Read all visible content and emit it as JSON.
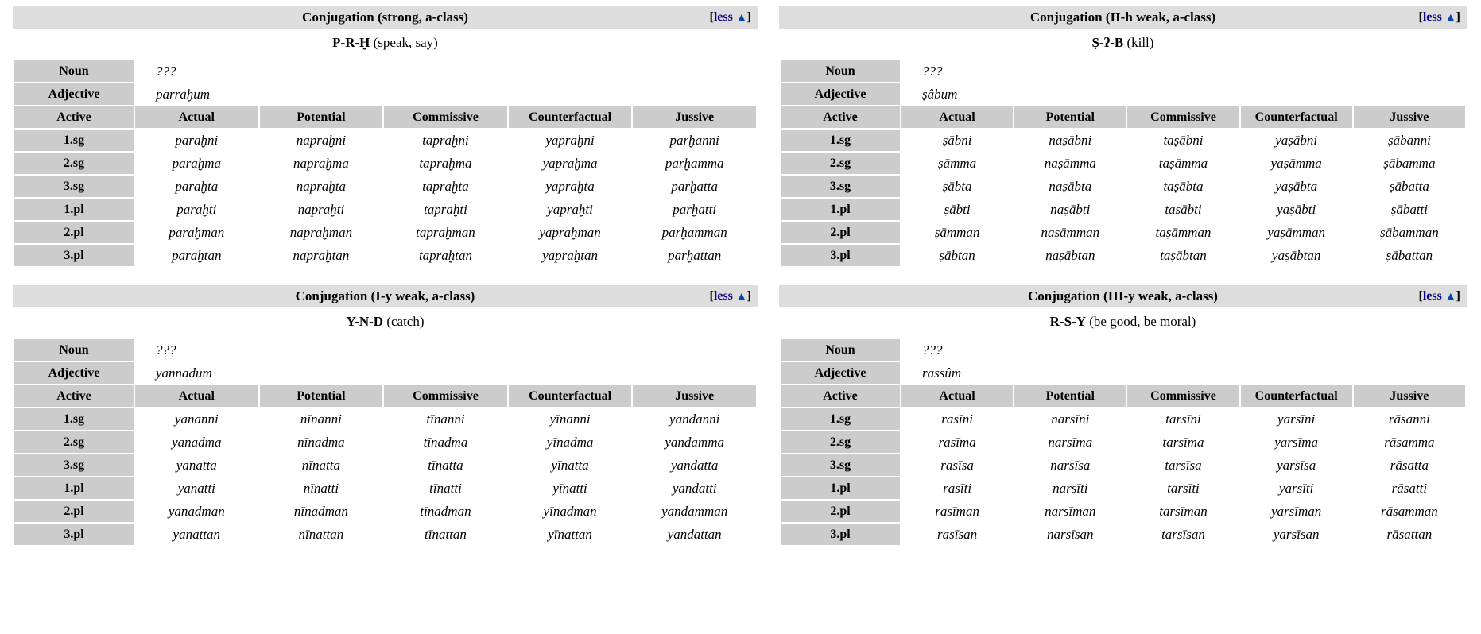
{
  "common": {
    "toggle_open_bracket": "[",
    "toggle_label": "less",
    "toggle_triangle": "▲",
    "toggle_close_bracket": "]",
    "noun_label": "Noun",
    "adjective_label": "Adjective",
    "active_label": "Active",
    "unknown_value": "???",
    "column_headers": [
      "Actual",
      "Potential",
      "Commissive",
      "Counterfactual",
      "Jussive"
    ],
    "person_labels": [
      "1.sg",
      "2.sg",
      "3.sg",
      "1.pl",
      "2.pl",
      "3.pl"
    ],
    "colors": {
      "title_bar_bg": "#dddddd",
      "cell_header_bg": "#cccccc",
      "link": "#0b0080",
      "triangle": "#0645ad",
      "text": "#000000",
      "page_bg": "#ffffff"
    }
  },
  "tables": [
    {
      "id": "strong-a-class",
      "title": "Conjugation (strong, a-class)",
      "root": "P-R-Ḫ",
      "gloss": "(speak, say)",
      "noun": "???",
      "adjective": "parraḫum",
      "rows": [
        {
          "person": "1.sg",
          "forms": [
            "paraḫni",
            "napraḫni",
            "tapraḫni",
            "yapraḫni",
            "parḫanni"
          ]
        },
        {
          "person": "2.sg",
          "forms": [
            "paraḫma",
            "napraḫma",
            "tapraḫma",
            "yapraḫma",
            "parḫamma"
          ]
        },
        {
          "person": "3.sg",
          "forms": [
            "paraḫta",
            "napraḫta",
            "tapraḫta",
            "yapraḫta",
            "parḫatta"
          ]
        },
        {
          "person": "1.pl",
          "forms": [
            "paraḫti",
            "napraḫti",
            "tapraḫti",
            "yapraḫti",
            "parḫatti"
          ]
        },
        {
          "person": "2.pl",
          "forms": [
            "paraḫman",
            "napraḫman",
            "tapraḫman",
            "yapraḫman",
            "parḫamman"
          ]
        },
        {
          "person": "3.pl",
          "forms": [
            "paraḫtan",
            "napraḫtan",
            "tapraḫtan",
            "yapraḫtan",
            "parḫattan"
          ]
        }
      ]
    },
    {
      "id": "ii-h-weak-a-class",
      "title": "Conjugation (II-h weak, a-class)",
      "root": "Ṣ-ʔ-B",
      "gloss": "(kill)",
      "noun": "???",
      "adjective": "ṣâbum",
      "rows": [
        {
          "person": "1.sg",
          "forms": [
            "ṣābni",
            "naṣābni",
            "taṣābni",
            "yaṣābni",
            "ṣābanni"
          ]
        },
        {
          "person": "2.sg",
          "forms": [
            "ṣāmma",
            "naṣāmma",
            "taṣāmma",
            "yaṣāmma",
            "ṣābamma"
          ]
        },
        {
          "person": "3.sg",
          "forms": [
            "ṣābta",
            "naṣābta",
            "taṣābta",
            "yaṣābta",
            "ṣābatta"
          ]
        },
        {
          "person": "1.pl",
          "forms": [
            "ṣābti",
            "naṣābti",
            "taṣābti",
            "yaṣābti",
            "ṣābatti"
          ]
        },
        {
          "person": "2.pl",
          "forms": [
            "ṣāmman",
            "naṣāmman",
            "taṣāmman",
            "yaṣāmman",
            "ṣābamman"
          ]
        },
        {
          "person": "3.pl",
          "forms": [
            "ṣābtan",
            "naṣābtan",
            "taṣābtan",
            "yaṣābtan",
            "ṣābattan"
          ]
        }
      ]
    },
    {
      "id": "i-y-weak-a-class",
      "title": "Conjugation (I-y weak, a-class)",
      "root": "Y-N-D",
      "gloss": "(catch)",
      "noun": "???",
      "adjective": "yannadum",
      "rows": [
        {
          "person": "1.sg",
          "forms": [
            "yananni",
            "nīnanni",
            "tīnanni",
            "yīnanni",
            "yandanni"
          ]
        },
        {
          "person": "2.sg",
          "forms": [
            "yanadma",
            "nīnadma",
            "tīnadma",
            "yīnadma",
            "yandamma"
          ]
        },
        {
          "person": "3.sg",
          "forms": [
            "yanatta",
            "nīnatta",
            "tīnatta",
            "yīnatta",
            "yandatta"
          ]
        },
        {
          "person": "1.pl",
          "forms": [
            "yanatti",
            "nīnatti",
            "tīnatti",
            "yīnatti",
            "yandatti"
          ]
        },
        {
          "person": "2.pl",
          "forms": [
            "yanadman",
            "nīnadman",
            "tīnadman",
            "yīnadman",
            "yandamman"
          ]
        },
        {
          "person": "3.pl",
          "forms": [
            "yanattan",
            "nīnattan",
            "tīnattan",
            "yīnattan",
            "yandattan"
          ]
        }
      ]
    },
    {
      "id": "iii-y-weak-a-class",
      "title": "Conjugation (III-y weak, a-class)",
      "root": "R-S-Y",
      "gloss": "(be good, be moral)",
      "noun": "???",
      "adjective": "rassûm",
      "rows": [
        {
          "person": "1.sg",
          "forms": [
            "rasīni",
            "narsīni",
            "tarsīni",
            "yarsīni",
            "rāsanni"
          ]
        },
        {
          "person": "2.sg",
          "forms": [
            "rasīma",
            "narsīma",
            "tarsīma",
            "yarsīma",
            "rāsamma"
          ]
        },
        {
          "person": "3.sg",
          "forms": [
            "rasīsa",
            "narsīsa",
            "tarsīsa",
            "yarsīsa",
            "rāsatta"
          ]
        },
        {
          "person": "1.pl",
          "forms": [
            "rasīti",
            "narsīti",
            "tarsīti",
            "yarsīti",
            "rāsatti"
          ]
        },
        {
          "person": "2.pl",
          "forms": [
            "rasīman",
            "narsīman",
            "tarsīman",
            "yarsīman",
            "rāsamman"
          ]
        },
        {
          "person": "3.pl",
          "forms": [
            "rasīsan",
            "narsīsan",
            "tarsīsan",
            "yarsīsan",
            "rāsattan"
          ]
        }
      ]
    }
  ]
}
